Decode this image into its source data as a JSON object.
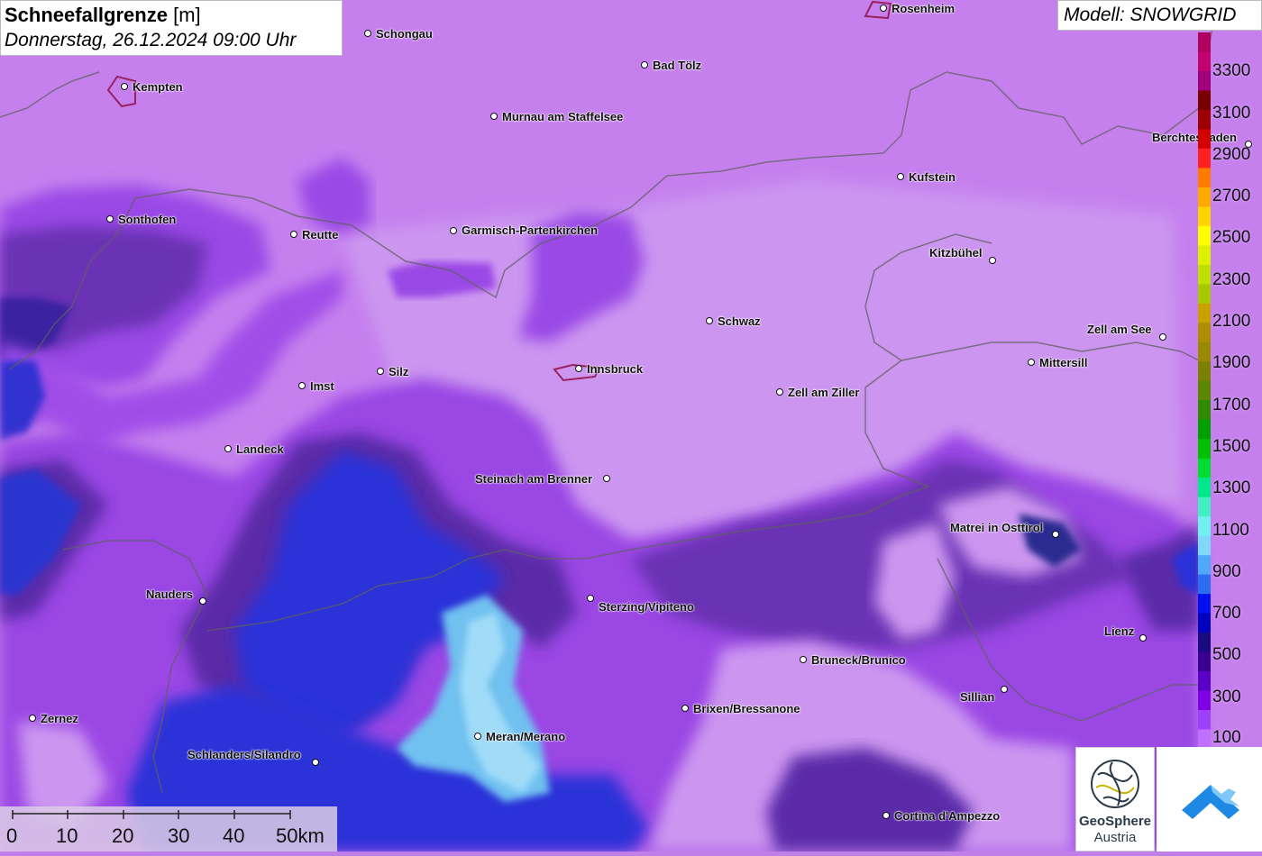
{
  "title": {
    "main": "Schneefallgrenze",
    "unit": "[m]",
    "datetime": "Donnerstag, 26.12.2024 09:00 Uhr"
  },
  "model_label": "Modell: SNOWGRID",
  "cities": [
    {
      "name": "Rosenheim"
    },
    {
      "name": "Schongau"
    },
    {
      "name": "Kempten"
    },
    {
      "name": "Bad Tölz"
    },
    {
      "name": "Murnau am Staffelsee"
    },
    {
      "name": "Berchtesgaden"
    },
    {
      "name": "Kufstein"
    },
    {
      "name": "Sonthofen"
    },
    {
      "name": "Reutte"
    },
    {
      "name": "Garmisch-Partenkirchen"
    },
    {
      "name": "Kitzbühel"
    },
    {
      "name": "Schwaz"
    },
    {
      "name": "Zell am See"
    },
    {
      "name": "Mittersill"
    },
    {
      "name": "Silz"
    },
    {
      "name": "Innsbruck"
    },
    {
      "name": "Imst"
    },
    {
      "name": "Zell am Ziller"
    },
    {
      "name": "Landeck"
    },
    {
      "name": "Steinach am Brenner"
    },
    {
      "name": "Matrei in Osttirol"
    },
    {
      "name": "Nauders"
    },
    {
      "name": "Sterzing/Vipiteno"
    },
    {
      "name": "Lienz"
    },
    {
      "name": "Bruneck/Brunico"
    },
    {
      "name": "Sillian"
    },
    {
      "name": "Brixen/Bressanone"
    },
    {
      "name": "Zernez"
    },
    {
      "name": "Meran/Merano"
    },
    {
      "name": "Schlanders/Silandro"
    },
    {
      "name": "Cortina d'Ampezzo"
    }
  ],
  "legend": {
    "labels": [
      "3300",
      "3100",
      "2900",
      "2700",
      "2500",
      "2300",
      "2100",
      "1900",
      "1700",
      "1500",
      "1300",
      "1100",
      "900",
      "700",
      "500",
      "300",
      "100"
    ],
    "colors": [
      "#b0005e",
      "#c2006e",
      "#a0007a",
      "#7a0000",
      "#9c0000",
      "#d40000",
      "#ff2020",
      "#ff7a00",
      "#ffaa00",
      "#ffd400",
      "#ffff00",
      "#ddf000",
      "#c0e000",
      "#a8c800",
      "#c8a000",
      "#b08c00",
      "#988a00",
      "#7a8000",
      "#5a8800",
      "#2e8c00",
      "#00a000",
      "#00c000",
      "#00dd30",
      "#00e88a",
      "#40f0c0",
      "#70f0f0",
      "#80d8f8",
      "#50a8f8",
      "#2c6cf0",
      "#0010f0",
      "#0000c0",
      "#1a0a80",
      "#3a0090",
      "#5a00c8",
      "#8000e8",
      "#a040ff",
      "#c070ff"
    ]
  },
  "scale": {
    "labels": [
      "0",
      "10",
      "20",
      "30",
      "40",
      "50km"
    ]
  },
  "logo": {
    "name": "GeoSphere",
    "sub": "Austria"
  },
  "colors": {
    "background": "#c07ee8",
    "light_area": "#cc90f0",
    "mid_purple": "#9040e0",
    "dark_purple": "#5a2aa0",
    "deep_blue": "#2a30d8",
    "light_blue": "#6ab8f0",
    "boundary": "#606060"
  }
}
